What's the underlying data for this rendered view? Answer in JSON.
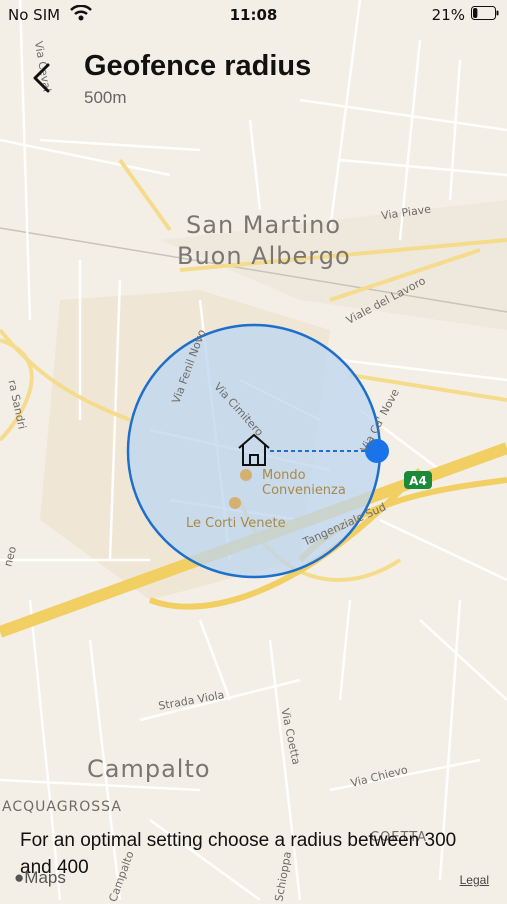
{
  "status_bar": {
    "carrier": "No SIM",
    "time": "11:08",
    "battery": "21%",
    "battery_level": 0.21
  },
  "header": {
    "back_icon": "chevron-left-icon",
    "title": "Geofence radius",
    "subtitle": "500m"
  },
  "map": {
    "towns": [
      "San Martino",
      "Buon Albergo",
      "Campalto"
    ],
    "streets": [
      "Via Piave",
      "Viale del Lavoro",
      "Via Fenil Novo",
      "Via Cimitero",
      "Via Ca' Nove",
      "Tangenziale Sud",
      "Strada Viola",
      "Via Coetta",
      "Via Chievo",
      "Via Ceval",
      "ra Sandri",
      "neo",
      "Schioppa",
      "Campalto"
    ],
    "areas": [
      "ACQUAGROSSA",
      "COETTA"
    ],
    "pois": [
      "Mondo Convenienza",
      "Le Corti Venete"
    ],
    "shield": "A4",
    "home_icon": "home-icon",
    "radius_handle_icon": "radius-handle"
  },
  "footer": {
    "hint": "For an optimal setting choose a radius between 300 and 400",
    "maps": "Maps",
    "legal": "Legal"
  },
  "colors": {
    "circle_fill": "#bcd6f0",
    "circle_stroke": "#1d6fcc",
    "handle": "#1a73e8",
    "highway": "#f2cf63",
    "background": "#f4efe6"
  }
}
